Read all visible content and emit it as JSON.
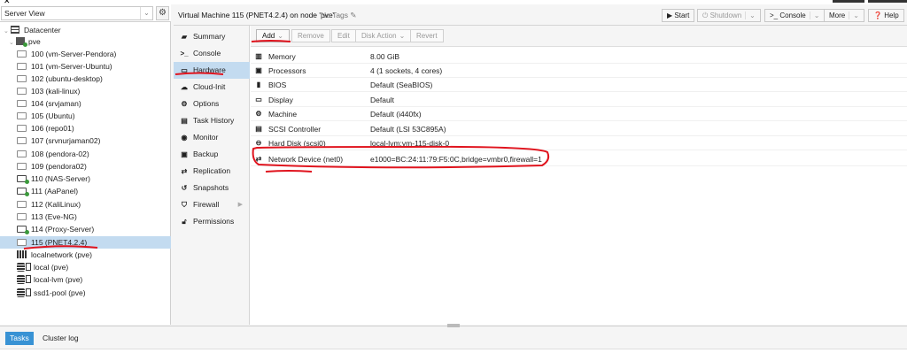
{
  "left_panel": {
    "view_select": "Server View",
    "tree": [
      {
        "label": "Datacenter",
        "kind": "datacenter"
      },
      {
        "label": "pve",
        "kind": "node"
      },
      {
        "label": "100 (vm-Server-Pendora)",
        "kind": "vm",
        "running": false
      },
      {
        "label": "101 (vm-Server-Ubuntu)",
        "kind": "vm",
        "running": false
      },
      {
        "label": "102 (ubuntu-desktop)",
        "kind": "vm",
        "running": false
      },
      {
        "label": "103 (kali-linux)",
        "kind": "vm",
        "running": false
      },
      {
        "label": "104 (srvjaman)",
        "kind": "vm",
        "running": false
      },
      {
        "label": "105 (Ubuntu)",
        "kind": "vm",
        "running": false
      },
      {
        "label": "106 (repo01)",
        "kind": "vm",
        "running": false
      },
      {
        "label": "107 (srvnurjaman02)",
        "kind": "vm",
        "running": false
      },
      {
        "label": "108 (pendora-02)",
        "kind": "vm",
        "running": false
      },
      {
        "label": "109 (pendora02)",
        "kind": "vm",
        "running": false
      },
      {
        "label": "110 (NAS-Server)",
        "kind": "vm",
        "running": true
      },
      {
        "label": "111 (AaPanel)",
        "kind": "vm",
        "running": true
      },
      {
        "label": "112 (KaliLinux)",
        "kind": "vm",
        "running": false
      },
      {
        "label": "113 (Eve-NG)",
        "kind": "vm",
        "running": false
      },
      {
        "label": "114 (Proxy-Server)",
        "kind": "vm",
        "running": true
      },
      {
        "label": "115 (PNET4.2.4)",
        "kind": "vm",
        "running": false,
        "selected": true
      },
      {
        "label": "localnetwork (pve)",
        "kind": "network"
      },
      {
        "label": "local (pve)",
        "kind": "storage"
      },
      {
        "label": "local-lvm (pve)",
        "kind": "storage"
      },
      {
        "label": "ssd1-pool (pve)",
        "kind": "storage"
      }
    ]
  },
  "header": {
    "title": "Virtual Machine 115 (PNET4.2.4) on node 'pve'",
    "tags": "No Tags",
    "start": "Start",
    "shutdown": "Shutdown",
    "console": "Console",
    "more": "More",
    "help": "Help"
  },
  "menu": [
    {
      "label": "Summary",
      "icon": "book-icon"
    },
    {
      "label": "Console",
      "icon": "terminal-icon"
    },
    {
      "label": "Hardware",
      "icon": "monitor-icon",
      "active": true
    },
    {
      "label": "Cloud-Init",
      "icon": "cloud-icon"
    },
    {
      "label": "Options",
      "icon": "gear-icon"
    },
    {
      "label": "Task History",
      "icon": "list-icon"
    },
    {
      "label": "Monitor",
      "icon": "eye-icon"
    },
    {
      "label": "Backup",
      "icon": "floppy-icon"
    },
    {
      "label": "Replication",
      "icon": "retweet-icon"
    },
    {
      "label": "Snapshots",
      "icon": "history-icon"
    },
    {
      "label": "Firewall",
      "icon": "shield-icon"
    },
    {
      "label": "Permissions",
      "icon": "unlock-icon"
    }
  ],
  "toolbar": {
    "add": "Add",
    "remove": "Remove",
    "edit": "Edit",
    "disk_action": "Disk Action",
    "revert": "Revert"
  },
  "hardware": [
    {
      "key": "Memory",
      "value": "8.00 GiB",
      "icon": "memory-icon"
    },
    {
      "key": "Processors",
      "value": "4 (1 sockets, 4 cores)",
      "icon": "cpu-icon"
    },
    {
      "key": "BIOS",
      "value": "Default (SeaBIOS)",
      "icon": "chip-icon"
    },
    {
      "key": "Display",
      "value": "Default",
      "icon": "desktop-icon"
    },
    {
      "key": "Machine",
      "value": "Default (i440fx)",
      "icon": "cogs-icon"
    },
    {
      "key": "SCSI Controller",
      "value": "Default (LSI 53C895A)",
      "icon": "database-icon"
    },
    {
      "key": "Hard Disk (scsi0)",
      "value": "local-lvm:vm-115-disk-0",
      "icon": "hdd-icon"
    },
    {
      "key": "Network Device (net0)",
      "value": "e1000=BC:24:11:79:F5:0C,bridge=vmbr0,firewall=1",
      "icon": "exchange-icon"
    }
  ],
  "bottom": {
    "tasks": "Tasks",
    "cluster_log": "Cluster log"
  },
  "annotation_color": "#e0141e"
}
